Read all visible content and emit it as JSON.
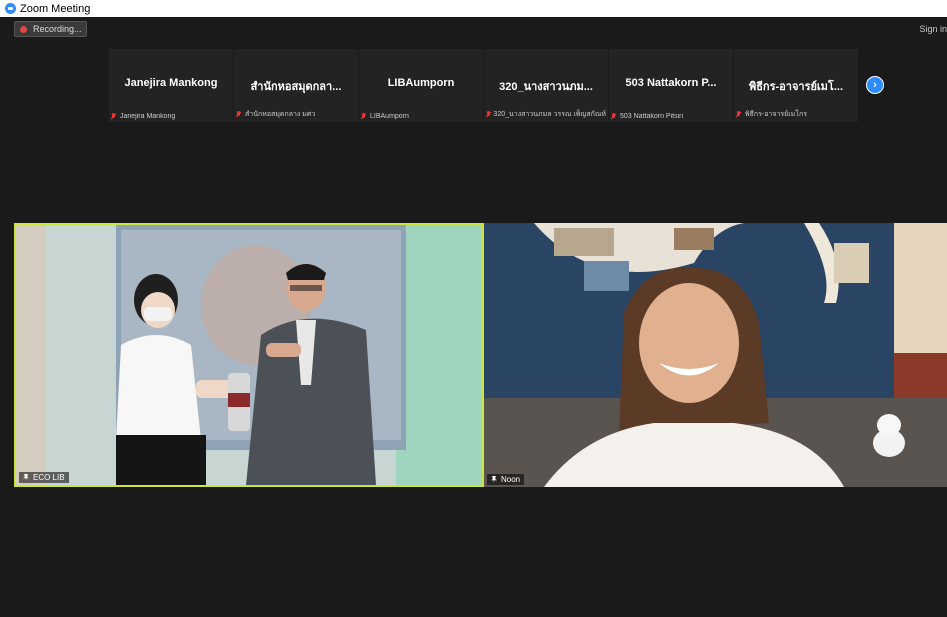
{
  "window": {
    "title": "Zoom Meeting"
  },
  "toolbar": {
    "recording_label": "Recording...",
    "sign_in": "Sign in"
  },
  "gallery": {
    "participants": [
      {
        "name": "Janejira Mankong",
        "label": "Janejira Mankong"
      },
      {
        "name": "สำนักหอสมุดกลา...",
        "label": "สำนักหอสมุดกลาง มศว"
      },
      {
        "name": "LIBAumporn",
        "label": "LIBAumporn"
      },
      {
        "name": "320_นางสาวนภม...",
        "label": "320_นางสาวนภมล วรรณ เพ็ญสกัณห์"
      },
      {
        "name": "503 Nattakorn P...",
        "label": "503 Nattakorn Pitsiri"
      },
      {
        "name": "พิธีกร-อาจารย์เมโ...",
        "label": "พิธีกร-อาจารย์เมโกร"
      }
    ],
    "next_icon": "chevron-right-icon"
  },
  "videos": [
    {
      "name": "ECO LIB"
    },
    {
      "name": "Noon"
    }
  ],
  "colors": {
    "accent": "#2d8cff",
    "active_speaker": "#c9e63e",
    "muted": "#e33333"
  }
}
